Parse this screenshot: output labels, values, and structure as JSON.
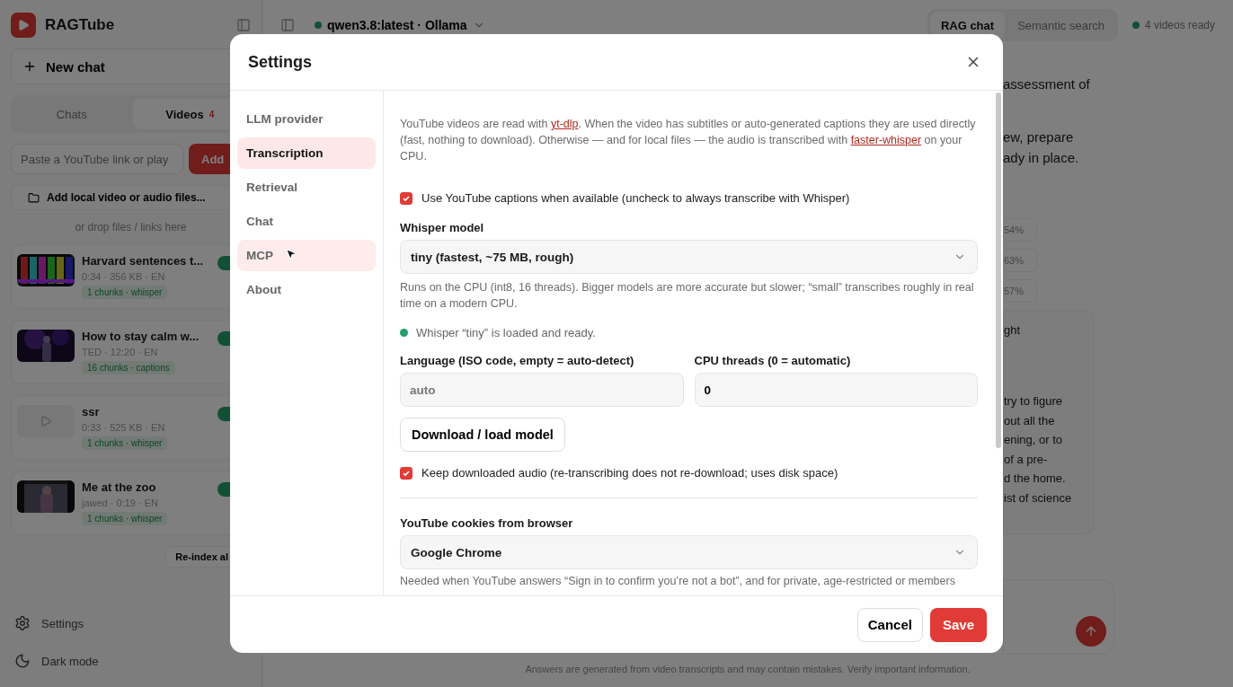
{
  "app": {
    "name": "RAGTube"
  },
  "sidebar": {
    "new_chat": "New chat",
    "tabs": [
      {
        "label": "Chats",
        "selected": false
      },
      {
        "label": "Videos",
        "selected": true,
        "badge": "4"
      }
    ],
    "url_field": {
      "placeholder": "Paste a YouTube link or play"
    },
    "add_button": "Add",
    "local_button": "Add local video or audio files...",
    "drop_hint": "or drop files / links here",
    "videos": [
      {
        "title": "Harvard sentences t...",
        "meta": "0:34 · 356 KB · EN",
        "tag": "1 chunks · whisper",
        "enabled": true
      },
      {
        "title": "How to stay calm w...",
        "meta": "TED · 12:20 · EN",
        "tag": "16 chunks · captions",
        "enabled": true
      },
      {
        "title": "ssr",
        "meta": "0:33 · 525 KB · EN",
        "tag": "1 chunks · whisper",
        "enabled": true,
        "thumb": {
          "kind": "placeholder"
        }
      },
      {
        "title": "Me at the zoo",
        "meta": "jawed · 0:19 · EN",
        "tag": "1 chunks · whisper",
        "enabled": true
      }
    ],
    "reindex": "Re-index al",
    "footer": [
      {
        "kind": "settings",
        "label": "Settings"
      },
      {
        "kind": "dark",
        "label": "Dark mode"
      }
    ]
  },
  "header": {
    "model": "qwen3.8:latest · Ollama",
    "modes": [
      {
        "label": "RAG chat",
        "selected": true
      },
      {
        "label": "Semantic search",
        "selected": false
      }
    ],
    "status": "4 videos ready"
  },
  "chat": {
    "lines_top": [
      "assessment of"
    ],
    "lines_mid": [
      "ew, prepare",
      "ady in place."
    ],
    "sources": [
      "54%",
      "63%",
      "57%"
    ],
    "card_title": "ght",
    "card_lines": [
      "try to figure",
      "out all the",
      "ening, or to",
      "of a pre-",
      "d the home.",
      "ist of science"
    ]
  },
  "disclaimer": "Answers are generated from video transcripts and may contain mistakes. Verify important information.",
  "settings": {
    "title": "Settings",
    "nav": [
      {
        "label": "LLM provider",
        "selected": false,
        "hovered": false
      },
      {
        "label": "Transcription",
        "selected": true,
        "hovered": false
      },
      {
        "label": "Retrieval",
        "selected": false,
        "hovered": false
      },
      {
        "label": "Chat",
        "selected": false,
        "hovered": false
      },
      {
        "label": "MCP",
        "selected": false,
        "hovered": true
      },
      {
        "label": "About",
        "selected": false,
        "hovered": false
      }
    ],
    "intro": [
      {
        "kind": "text",
        "text": "YouTube videos are read with "
      },
      {
        "kind": "link",
        "text": "yt-dlp"
      },
      {
        "kind": "text",
        "text": ". When the video has subtitles or auto-generated captions they are used directly (fast, nothing to download). Otherwise — and for local files — the audio is transcribed with "
      },
      {
        "kind": "link",
        "text": "faster-whisper"
      },
      {
        "kind": "text",
        "text": " on your CPU."
      }
    ],
    "use_captions": {
      "label": "Use YouTube captions when available (uncheck to always transcribe with Whisper)",
      "checked": true
    },
    "whisper_model": {
      "label": "Whisper model",
      "value": "tiny (fastest, ~75 MB, rough)",
      "hint": "Runs on the CPU (int8, 16 threads). Bigger models are more accurate but slower; “small” transcribes roughly in real time on a modern CPU."
    },
    "model_status": {
      "text": "Whisper “tiny” is loaded and ready.",
      "color": "#22a06b"
    },
    "language": {
      "label": "Language (ISO code, empty = auto-detect)",
      "placeholder": "auto"
    },
    "threads": {
      "label": "CPU threads (0 = automatic)",
      "value": "0"
    },
    "download_button": "Download / load model",
    "keep_audio": {
      "label": "Keep downloaded audio (re-transcribing does not re-download; uses disk space)",
      "checked": true
    },
    "cookies": {
      "label": "YouTube cookies from browser",
      "value": "Google Chrome",
      "hint": "Needed when YouTube answers “Sign in to confirm you’re not a bot”, and for private, age-restricted or members"
    },
    "cancel": "Cancel",
    "save": "Save"
  }
}
